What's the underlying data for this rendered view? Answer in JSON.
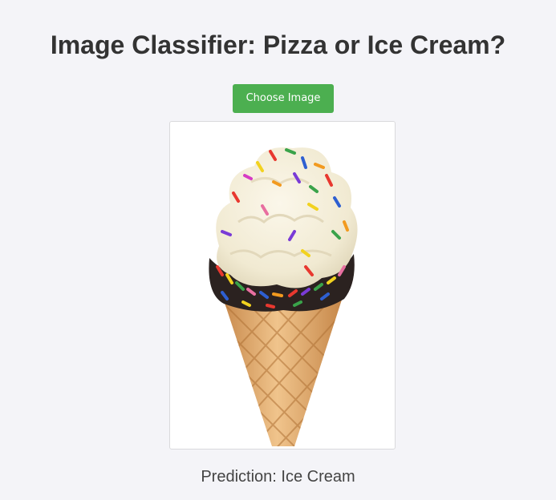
{
  "header": {
    "title": "Image Classifier: Pizza or Ice Cream?"
  },
  "upload": {
    "button_label": "Choose Image"
  },
  "preview": {
    "subject": "ice-cream-cone-with-sprinkles"
  },
  "result": {
    "prediction_text": "Prediction: Ice Cream"
  },
  "colors": {
    "background": "#f4f4f8",
    "button": "#4caf50",
    "button_text": "#ffffff",
    "title_text": "#333333",
    "prediction_text": "#444444"
  }
}
